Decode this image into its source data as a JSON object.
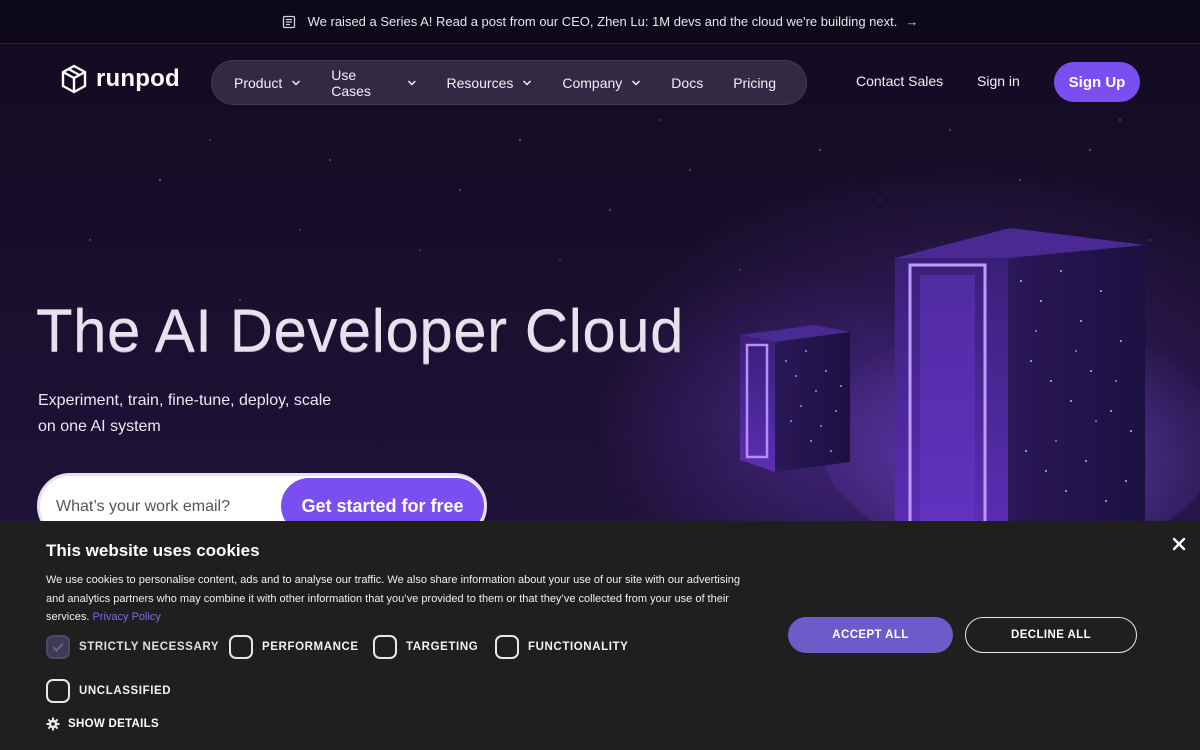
{
  "announcement": {
    "text": "We raised a Series A! Read a post from our CEO, Zhen Lu: 1M devs and the cloud we're building next.",
    "arrow": "→"
  },
  "header": {
    "logo_text": "runpod",
    "nav": [
      {
        "label": "Product",
        "has_dropdown": true
      },
      {
        "label": "Use Cases",
        "has_dropdown": true
      },
      {
        "label": "Resources",
        "has_dropdown": true
      },
      {
        "label": "Company",
        "has_dropdown": true
      },
      {
        "label": "Docs",
        "has_dropdown": false
      },
      {
        "label": "Pricing",
        "has_dropdown": false
      }
    ],
    "contact_sales": "Contact Sales",
    "sign_in": "Sign in",
    "sign_up": "Sign Up"
  },
  "hero": {
    "title": "The AI Developer Cloud",
    "subtitle_line1": "Experiment, train, fine-tune, deploy, scale",
    "subtitle_line2": "on one AI system",
    "email_placeholder": "What’s your work email?",
    "cta": "Get started for free"
  },
  "cookie_banner": {
    "title": "This website uses cookies",
    "text": "We use cookies to personalise content, ads and to analyse our traffic. We also share information about your use of our site with our advertising and analytics partners who may combine it with other information that you’ve provided to them or that they’ve collected from your use of their services.",
    "privacy_link": "Privacy Policy",
    "categories": [
      {
        "label": "STRICTLY NECESSARY",
        "checked": true
      },
      {
        "label": "PERFORMANCE",
        "checked": false
      },
      {
        "label": "TARGETING",
        "checked": false
      },
      {
        "label": "FUNCTIONALITY",
        "checked": false
      },
      {
        "label": "UNCLASSIFIED",
        "checked": false
      }
    ],
    "show_details": "SHOW DETAILS",
    "accept_all": "ACCEPT ALL",
    "decline_all": "DECLINE ALL"
  },
  "colors": {
    "accent": "#7a4ef0",
    "background": "#140d22",
    "cookie_bg": "#1f1f1f",
    "accept_button": "#6b5cc9",
    "privacy_link": "#7a6ce0"
  },
  "icons": {
    "announcement": "newspaper-icon",
    "logo": "cube-logo-icon",
    "dropdown": "chevron-down-icon",
    "close": "close-icon",
    "settings": "gear-icon",
    "check": "check-icon"
  }
}
